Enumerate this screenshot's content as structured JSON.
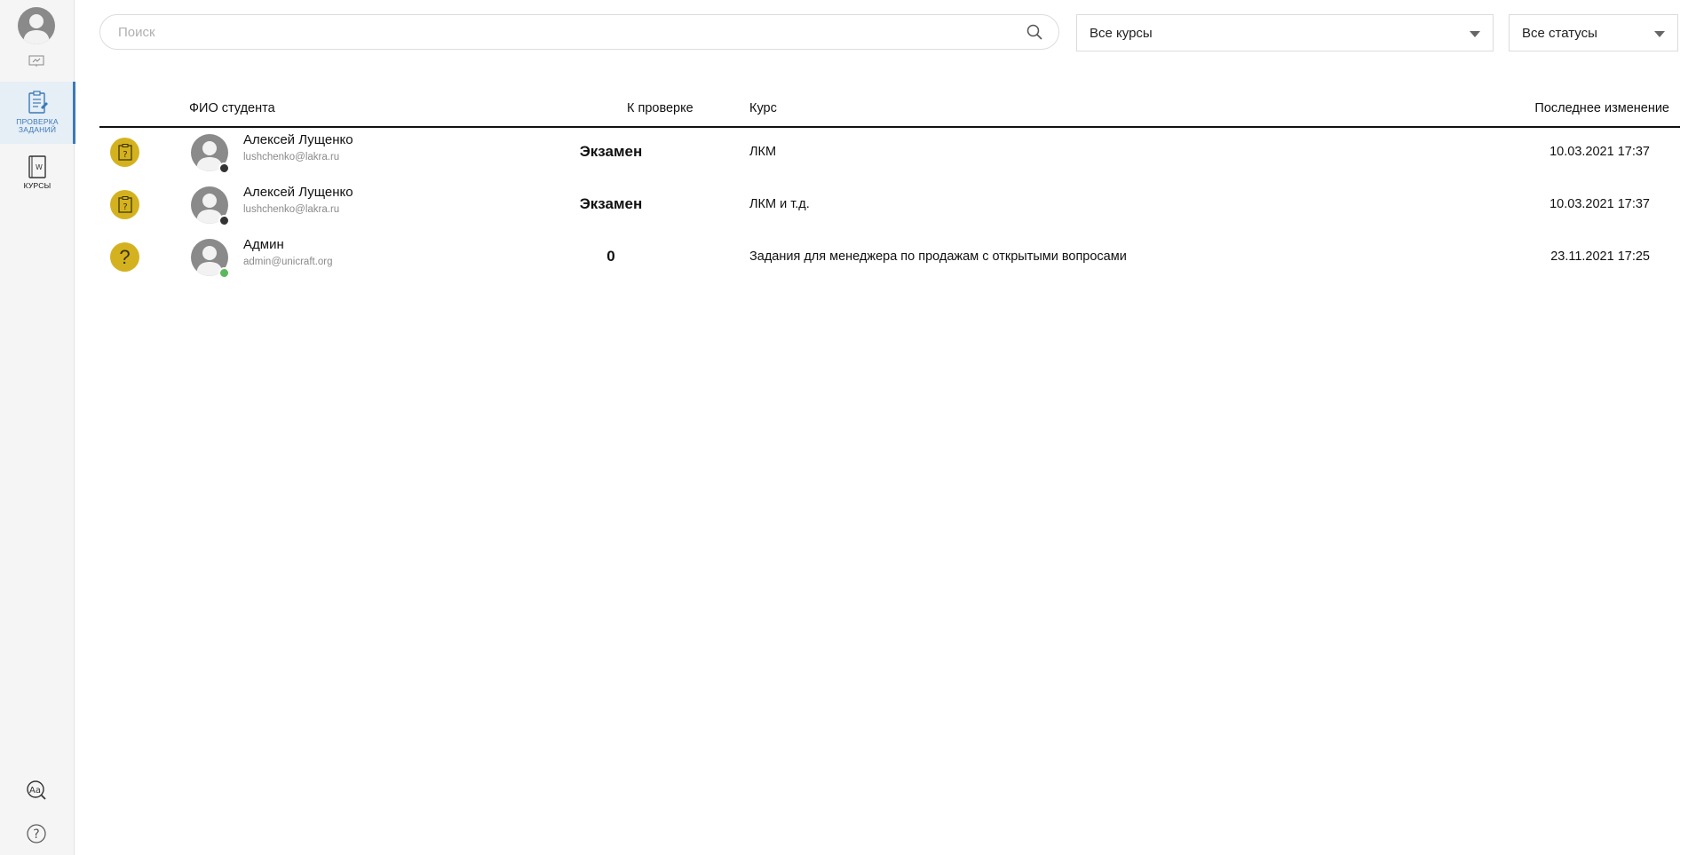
{
  "sidebar": {
    "nav": [
      {
        "label_line1": "ПРОВЕРКА",
        "label_line2": "ЗАДАНИЙ",
        "icon": "task-review-icon",
        "active": true
      },
      {
        "label_line1": "КУРСЫ",
        "label_line2": "",
        "icon": "courses-book-icon",
        "active": false
      }
    ],
    "bottom_icons": [
      "font-settings-icon",
      "help-icon"
    ]
  },
  "filters": {
    "search_placeholder": "Поиск",
    "course_select": "Все курсы",
    "status_select": "Все статусы"
  },
  "table": {
    "columns": {
      "student": "ФИО студента",
      "review": "К проверке",
      "course": "Курс",
      "modified": "Последнее изменение"
    },
    "rows": [
      {
        "status_icon": "exam-document-icon",
        "name": "Алексей Лущенко",
        "email": "lushchenko@lakra.ru",
        "online": false,
        "review": "Экзамен",
        "course": "ЛКМ",
        "modified": "10.03.2021 17:37"
      },
      {
        "status_icon": "exam-document-icon",
        "name": "Алексей Лущенко",
        "email": "lushchenko@lakra.ru",
        "online": false,
        "review": "Экзамен",
        "course": "ЛКМ и т.д.",
        "modified": "10.03.2021 17:37"
      },
      {
        "status_icon": "question-icon",
        "name": "Админ",
        "email": "admin@unicraft.org",
        "online": true,
        "review": "0",
        "course": "Задания для менеджера по продажам с открытыми вопросами",
        "modified": "23.11.2021 17:25"
      }
    ]
  },
  "colors": {
    "accent": "#3a79b8",
    "status_badge": "#d4b21f",
    "online": "#5cb85c",
    "offline": "#333333"
  }
}
